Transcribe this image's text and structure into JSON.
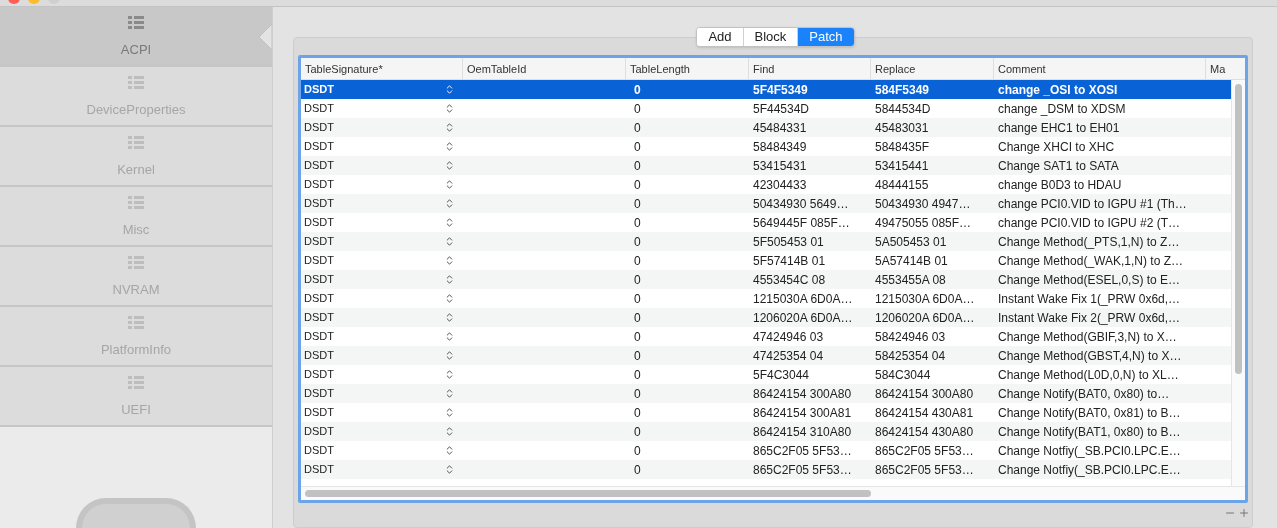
{
  "sidebar": {
    "items": [
      {
        "label": "ACPI",
        "selected": true
      },
      {
        "label": "DeviceProperties",
        "selected": false
      },
      {
        "label": "Kernel",
        "selected": false
      },
      {
        "label": "Misc",
        "selected": false
      },
      {
        "label": "NVRAM",
        "selected": false
      },
      {
        "label": "PlatformInfo",
        "selected": false
      },
      {
        "label": "UEFI",
        "selected": false
      }
    ]
  },
  "segments": [
    {
      "label": "Add",
      "selected": false
    },
    {
      "label": "Block",
      "selected": false
    },
    {
      "label": "Patch",
      "selected": true
    }
  ],
  "table": {
    "columns": [
      "TableSignature*",
      "OemTableId",
      "TableLength",
      "Find",
      "Replace",
      "Comment",
      "Ma"
    ],
    "rows": [
      {
        "table_signature": "DSDT",
        "table_length": "0",
        "find": "5F4F5349",
        "replace": "584F5349",
        "comment": "change _OSI to XOSI",
        "selected": true
      },
      {
        "table_signature": "DSDT",
        "table_length": "0",
        "find": "5F44534D",
        "replace": "5844534D",
        "comment": "change _DSM to XDSM",
        "selected": false
      },
      {
        "table_signature": "DSDT",
        "table_length": "0",
        "find": "45484331",
        "replace": "45483031",
        "comment": "change EHC1 to EH01",
        "selected": false
      },
      {
        "table_signature": "DSDT",
        "table_length": "0",
        "find": "58484349",
        "replace": "5848435F",
        "comment": "Change XHCI to XHC",
        "selected": false
      },
      {
        "table_signature": "DSDT",
        "table_length": "0",
        "find": "53415431",
        "replace": "53415441",
        "comment": "Change SAT1 to SATA",
        "selected": false
      },
      {
        "table_signature": "DSDT",
        "table_length": "0",
        "find": "42304433",
        "replace": "48444155",
        "comment": "change B0D3 to HDAU",
        "selected": false
      },
      {
        "table_signature": "DSDT",
        "table_length": "0",
        "find": "50434930 5649…",
        "replace": "50434930 4947…",
        "comment": "change PCI0.VID to IGPU #1 (Th…",
        "selected": false
      },
      {
        "table_signature": "DSDT",
        "table_length": "0",
        "find": "5649445F 085F…",
        "replace": "49475055 085F…",
        "comment": "change PCI0.VID to IGPU #2 (T…",
        "selected": false
      },
      {
        "table_signature": "DSDT",
        "table_length": "0",
        "find": "5F505453 01",
        "replace": "5A505453 01",
        "comment": "Change Method(_PTS,1,N) to Z…",
        "selected": false
      },
      {
        "table_signature": "DSDT",
        "table_length": "0",
        "find": "5F57414B 01",
        "replace": "5A57414B 01",
        "comment": "Change Method(_WAK,1,N) to Z…",
        "selected": false
      },
      {
        "table_signature": "DSDT",
        "table_length": "0",
        "find": "4553454C 08",
        "replace": "4553455A 08",
        "comment": "Change Method(ESEL,0,S) to E…",
        "selected": false
      },
      {
        "table_signature": "DSDT",
        "table_length": "0",
        "find": "1215030A 6D0A…",
        "replace": "1215030A 6D0A…",
        "comment": "Instant Wake Fix 1(_PRW 0x6d,…",
        "selected": false
      },
      {
        "table_signature": "DSDT",
        "table_length": "0",
        "find": "1206020A 6D0A…",
        "replace": "1206020A 6D0A…",
        "comment": "Instant Wake Fix 2(_PRW 0x6d,…",
        "selected": false
      },
      {
        "table_signature": "DSDT",
        "table_length": "0",
        "find": "47424946 03",
        "replace": "58424946 03",
        "comment": "Change Method(GBIF,3,N) to X…",
        "selected": false
      },
      {
        "table_signature": "DSDT",
        "table_length": "0",
        "find": "47425354 04",
        "replace": "58425354 04",
        "comment": "Change Method(GBST,4,N) to X…",
        "selected": false
      },
      {
        "table_signature": "DSDT",
        "table_length": "0",
        "find": "5F4C3044",
        "replace": "584C3044",
        "comment": "Change Method(L0D,0,N) to XL…",
        "selected": false
      },
      {
        "table_signature": "DSDT",
        "table_length": "0",
        "find": "86424154 300A80",
        "replace": "86424154 300A80",
        "comment": "Change Notify(BAT0, 0x80) to…",
        "selected": false
      },
      {
        "table_signature": "DSDT",
        "table_length": "0",
        "find": "86424154 300A81",
        "replace": "86424154 430A81",
        "comment": "Change Notify(BAT0, 0x81) to B…",
        "selected": false
      },
      {
        "table_signature": "DSDT",
        "table_length": "0",
        "find": "86424154 310A80",
        "replace": "86424154 430A80",
        "comment": "Change Notify(BAT1, 0x80) to B…",
        "selected": false
      },
      {
        "table_signature": "DSDT",
        "table_length": "0",
        "find": "865C2F05 5F53…",
        "replace": "865C2F05 5F53…",
        "comment": "Change Notfiy(_SB.PCI0.LPC.E…",
        "selected": false
      },
      {
        "table_signature": "DSDT",
        "table_length": "0",
        "find": "865C2F05 5F53…",
        "replace": "865C2F05 5F53…",
        "comment": "Change Notfiy(_SB.PCI0.LPC.E…",
        "selected": false
      }
    ]
  }
}
